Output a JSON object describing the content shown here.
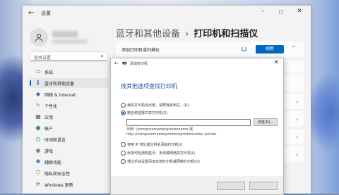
{
  "window": {
    "app_title": "设置",
    "controls": [
      "–",
      "☐",
      "✕"
    ]
  },
  "sidebar": {
    "search_placeholder": "查找设置",
    "items": [
      {
        "label": "系统",
        "icon": "monitor-icon",
        "color": "#2b7fd4"
      },
      {
        "label": "蓝牙和其他设备",
        "icon": "bluetooth-icon",
        "color": "#1f5fa8",
        "selected": true
      },
      {
        "label": "网络 & Internet",
        "icon": "wifi-icon",
        "color": "#3a6ea5"
      },
      {
        "label": "个性化",
        "icon": "brush-icon",
        "color": "#d07a2c"
      },
      {
        "label": "应用",
        "icon": "apps-icon",
        "color": "#5a5a7a"
      },
      {
        "label": "帐户",
        "icon": "person-icon",
        "color": "#2e9e6a"
      },
      {
        "label": "时间和语言",
        "icon": "globe-clock-icon",
        "color": "#1a7fc9"
      },
      {
        "label": "游戏",
        "icon": "gamepad-icon",
        "color": "#6b6b6b"
      },
      {
        "label": "辅助功能",
        "icon": "accessibility-icon",
        "color": "#1f6fbf"
      },
      {
        "label": "隐私和安全性",
        "icon": "shield-icon",
        "color": "#6b6b6b"
      },
      {
        "label": "Windows 更新",
        "icon": "update-icon",
        "color": "#1f6fbf"
      }
    ]
  },
  "main": {
    "breadcrumb_parent": "蓝牙和其他设备",
    "breadcrumb_sep": "›",
    "breadcrumb_current": "打印机和扫描仪",
    "add_label": "添加打印机或扫描仪",
    "refresh_label": "刷新"
  },
  "dialog": {
    "title": "添加打印机",
    "heading": "按其他选项查找打印机",
    "options": [
      {
        "label": "我的打印机有点老。请帮我找到它。(R)",
        "checked": false
      },
      {
        "label": "按名称选择共享打印机(S)",
        "checked": true
      },
      {
        "label": "使用 IP 地址或主机名添加打印机(I)",
        "checked": false
      },
      {
        "label": "添加可检测到蓝牙、无线或网络的打印机(L)",
        "checked": false
      },
      {
        "label": "通过手动设置添加本地打印机或网络打印机(O)",
        "checked": false
      }
    ],
    "browse_label": "浏览(R)...",
    "example_line1": "示例: \\\\computername\\printername 或",
    "example_line2": "http://computername/printers/printername/.printer"
  },
  "colors": {
    "accent": "#0067c0",
    "dialog_heading": "#1f4e96"
  }
}
